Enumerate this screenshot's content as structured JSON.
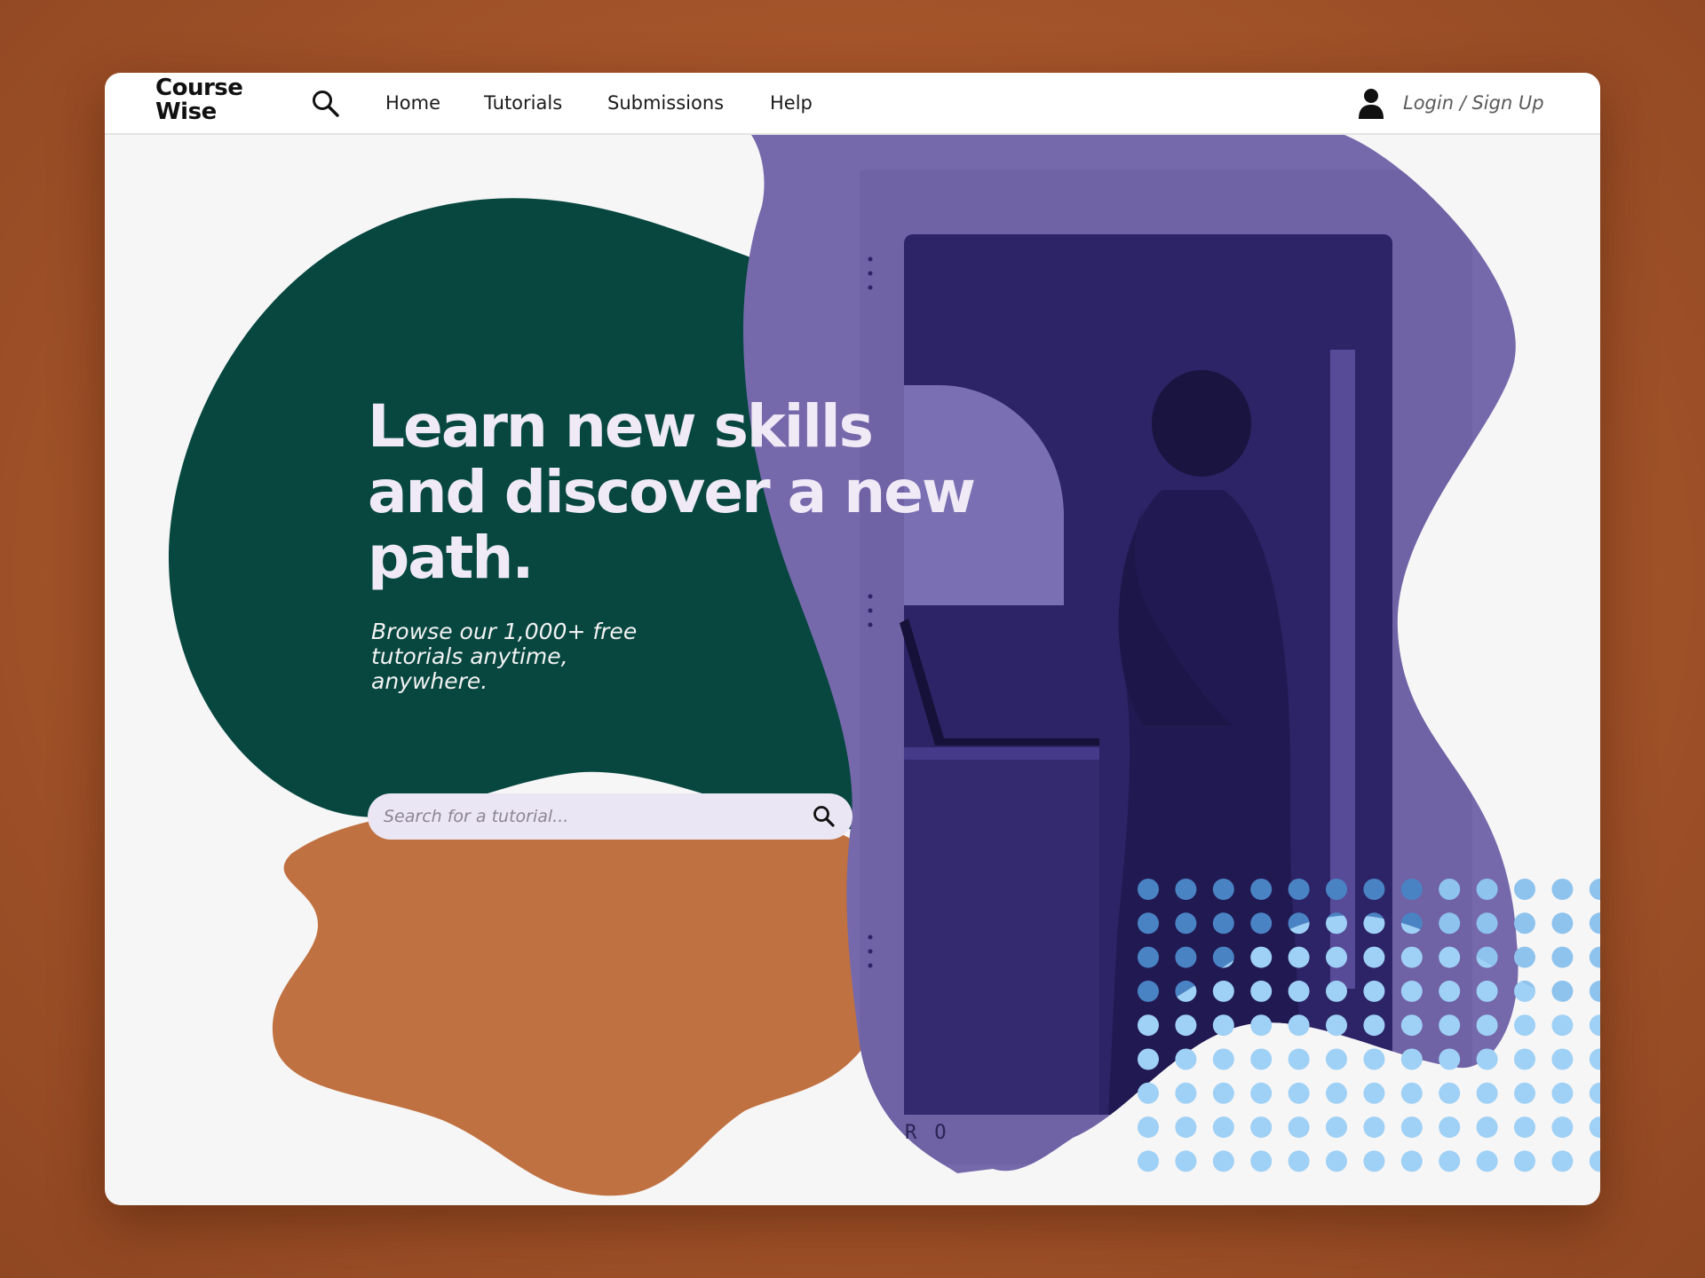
{
  "brand": {
    "name": "Course Wise"
  },
  "nav": {
    "links": [
      {
        "label": "Home"
      },
      {
        "label": "Tutorials"
      },
      {
        "label": "Submissions"
      },
      {
        "label": "Help"
      }
    ],
    "login_label": "Login / Sign Up"
  },
  "hero": {
    "headline": "Learn new skills and discover a new path.",
    "subhead": "Browse our 1,000+ free tutorials anytime, anywhere.",
    "sign_text": "RO"
  },
  "search": {
    "placeholder": "Search for a tutorial..."
  },
  "icons": {
    "nav_search": "search-icon",
    "user": "user-icon",
    "search_submit": "search-icon"
  },
  "colors": {
    "green_blob": "#074740",
    "orange_blob": "#c07141",
    "purple_blob": "#7669ab",
    "dot_dark": "#4a83c4",
    "dot_light": "#9fd0f5"
  }
}
